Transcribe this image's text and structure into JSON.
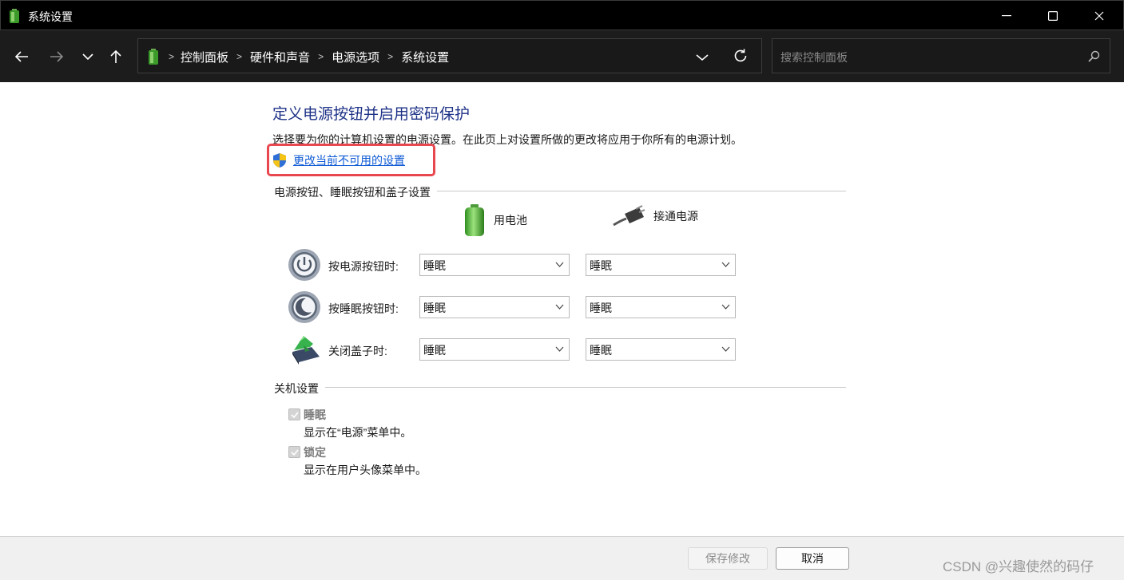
{
  "window": {
    "title": "系统设置",
    "minimize": "—",
    "maximize": "☐",
    "close": "✕"
  },
  "nav": {
    "breadcrumbs": [
      "控制面板",
      "硬件和声音",
      "电源选项",
      "系统设置"
    ],
    "search_placeholder": "搜索控制面板"
  },
  "main": {
    "heading": "定义电源按钮并启用密码保护",
    "description": "选择要为你的计算机设置的电源设置。在此页上对设置所做的更改将应用于你所有的电源计划。",
    "uac_link": "更改当前不可用的设置",
    "power_group_title": "电源按钮、睡眠按钮和盖子设置",
    "columns": {
      "battery": "用电池",
      "plugged": "接通电源"
    },
    "rows": [
      {
        "label": "按电源按钮时:",
        "battery": "睡眠",
        "plugged": "睡眠"
      },
      {
        "label": "按睡眠按钮时:",
        "battery": "睡眠",
        "plugged": "睡眠"
      },
      {
        "label": "关闭盖子时:",
        "battery": "睡眠",
        "plugged": "睡眠"
      }
    ],
    "shutdown_group_title": "关机设置",
    "shutdown_options": [
      {
        "title": "睡眠",
        "desc": "显示在“电源”菜单中。",
        "checked": true
      },
      {
        "title": "锁定",
        "desc": "显示在用户头像菜单中。",
        "checked": true
      }
    ]
  },
  "footer": {
    "save": "保存修改",
    "cancel": "取消",
    "watermark": "CSDN @兴趣使然的码仔"
  },
  "colors": {
    "heading": "#1e3287",
    "link": "#0f5bd6",
    "highlight": "#e8474f"
  }
}
